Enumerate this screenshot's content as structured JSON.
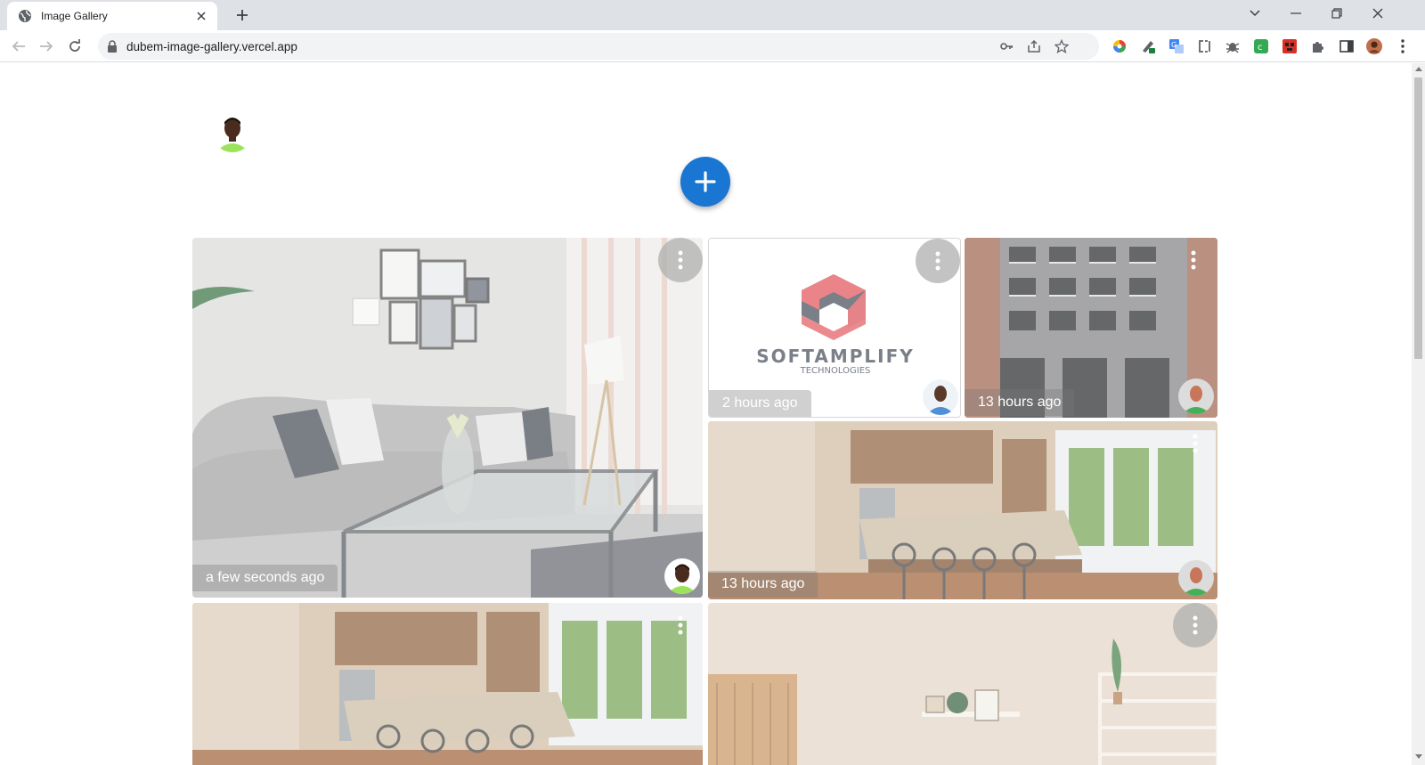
{
  "browser": {
    "tab_title": "Image Gallery",
    "url": "dubem-image-gallery.vercel.app"
  },
  "gallery": {
    "add_button_icon": "plus-icon",
    "cards": [
      {
        "id": "living-room",
        "time": "a few seconds ago",
        "subject": "living room with grey sofa and glass table"
      },
      {
        "id": "softamplify-logo",
        "time": "2 hours ago",
        "logo_text": "SOFTAMPLIFY",
        "logo_sub": "TECHNOLOGIES"
      },
      {
        "id": "building",
        "time": "13 hours ago",
        "subject": "brick apartment building facade"
      },
      {
        "id": "kitchen-1",
        "time": "13 hours ago",
        "subject": "wood kitchen with island and bar stools"
      },
      {
        "id": "kitchen-2",
        "time": "",
        "subject": "wood kitchen with island and bar stools"
      },
      {
        "id": "room-shelf",
        "time": "",
        "subject": "beige room with wall shelf and plants"
      }
    ]
  },
  "colors": {
    "accent": "#1976d2",
    "chrome_bg": "#dee1e6",
    "omnibox_bg": "#f1f3f4",
    "logo_red": "#e04a50",
    "logo_dark": "#3b4350"
  }
}
